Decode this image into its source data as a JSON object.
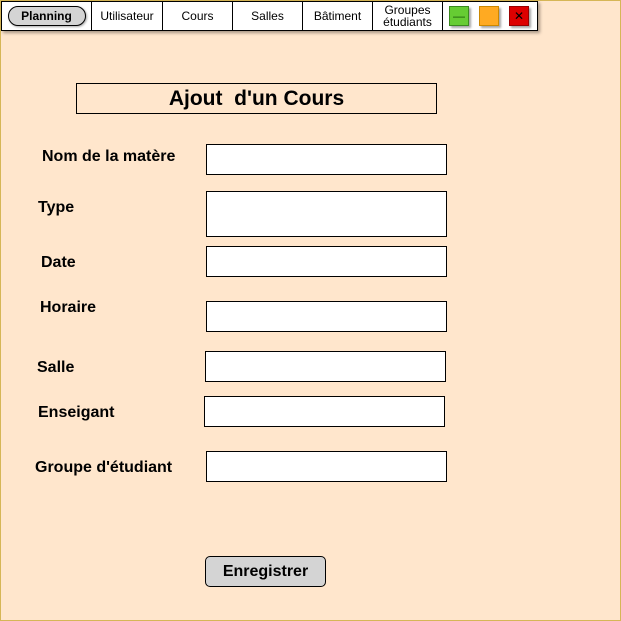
{
  "nav": {
    "items": [
      {
        "label": "Planning",
        "active": true
      },
      {
        "label": "Utilisateur"
      },
      {
        "label": "Cours"
      },
      {
        "label": "Salles"
      },
      {
        "label": "Bâtiment"
      },
      {
        "label": "Groupes\nétudiants"
      }
    ],
    "window_controls": [
      {
        "name": "minimize",
        "glyph": "—",
        "color": "#66cc33"
      },
      {
        "name": "maximize",
        "glyph": "",
        "color": "#ffaa22"
      },
      {
        "name": "close",
        "glyph": "✕",
        "color": "#dd0000"
      }
    ]
  },
  "form": {
    "title": "Ajout  d'un Cours",
    "fields": [
      {
        "label": "Nom de la matère",
        "value": "",
        "type": "text"
      },
      {
        "label": "Type",
        "value": "",
        "type": "textarea"
      },
      {
        "label": "Date",
        "value": "",
        "type": "text"
      },
      {
        "label": "Horaire",
        "value": "",
        "type": "text"
      },
      {
        "label": "Salle",
        "value": "",
        "type": "text"
      },
      {
        "label": "Enseigant",
        "value": "",
        "type": "text"
      },
      {
        "label": "Groupe d'étudiant",
        "value": "",
        "type": "text"
      }
    ],
    "submit_label": "Enregistrer"
  },
  "colors": {
    "page_background": "#ffe6cc",
    "page_border": "#d6b656",
    "button_background": "#d4d4d4"
  }
}
